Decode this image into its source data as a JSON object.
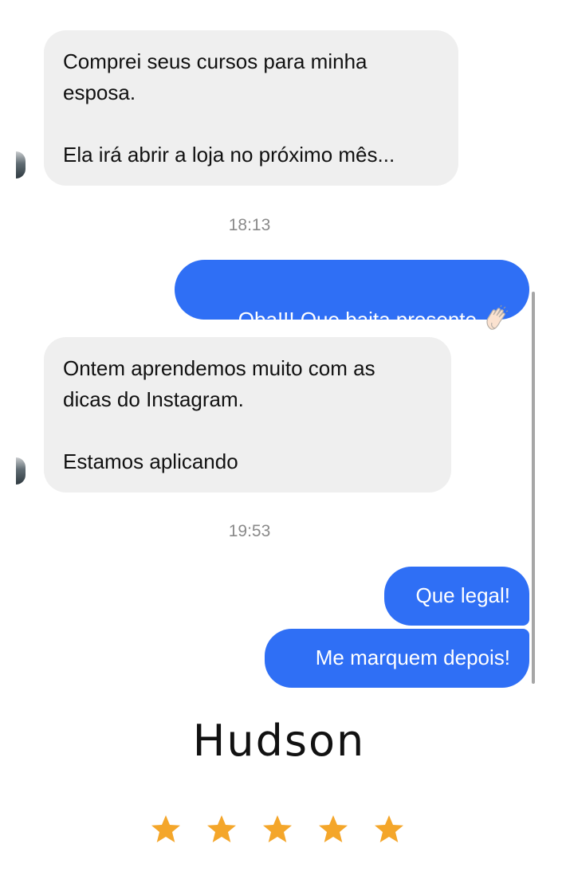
{
  "messages": {
    "incoming_1": "Comprei seus cursos para minha\nesposa.\n\nEla irá abrir a loja no próximo mês...",
    "time_1": "18:13",
    "outgoing_1": "Oba!!! Que baita presente",
    "incoming_2": "Ontem aprendemos muito com as\ndicas do Instagram.\n\nEstamos aplicando",
    "time_2": "19:53",
    "outgoing_2": "Que legal!",
    "outgoing_3": "Me marquem depois!"
  },
  "signature": {
    "name": "Hudson"
  },
  "rating": {
    "stars": 5,
    "max": 5,
    "star_color": "#f4a62a"
  },
  "colors": {
    "outgoing_bubble": "#2f6ff5",
    "incoming_bubble": "#efefef"
  },
  "icons": {
    "reaction": "clapping-hands-icon",
    "star": "star-icon"
  }
}
